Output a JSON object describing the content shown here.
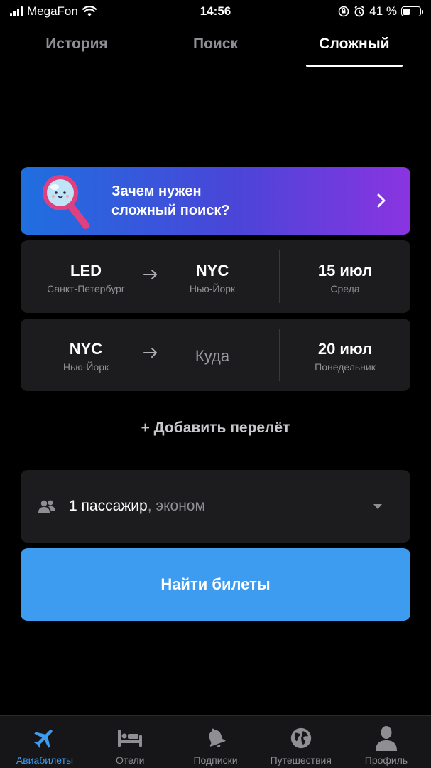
{
  "status_bar": {
    "carrier": "MegaFon",
    "time": "14:56",
    "battery": "41 %",
    "battery_level": 0.41
  },
  "tabs": [
    {
      "label": "История",
      "active": false
    },
    {
      "label": "Поиск",
      "active": false
    },
    {
      "label": "Сложный",
      "active": true
    }
  ],
  "promo": {
    "line1": "Зачем нужен",
    "line2": "сложный поиск?"
  },
  "flights": [
    {
      "from_code": "LED",
      "from_name": "Санкт-Петербург",
      "to_code": "NYC",
      "to_name": "Нью-Йорк",
      "date": "15 июл",
      "weekday": "Среда"
    },
    {
      "from_code": "NYC",
      "from_name": "Нью-Йорк",
      "to_placeholder": "Куда",
      "date": "20 июл",
      "weekday": "Понедельник"
    }
  ],
  "add_flight_label": "+ Добавить перелёт",
  "passengers": {
    "count": "1 пассажир",
    "class": ", эконом"
  },
  "search_button": "Найти билеты",
  "bottom_nav": [
    {
      "label": "Авиабилеты",
      "icon": "airplane-icon",
      "active": true
    },
    {
      "label": "Отели",
      "icon": "bed-icon",
      "active": false
    },
    {
      "label": "Подписки",
      "icon": "bell-icon",
      "active": false
    },
    {
      "label": "Путешествия",
      "icon": "globe-icon",
      "active": false
    },
    {
      "label": "Профиль",
      "icon": "person-icon",
      "active": false
    }
  ],
  "colors": {
    "accent": "#3d9bf0",
    "card": "#1c1c1e",
    "promo_start": "#1f6fe0",
    "promo_end": "#8a34e0"
  }
}
